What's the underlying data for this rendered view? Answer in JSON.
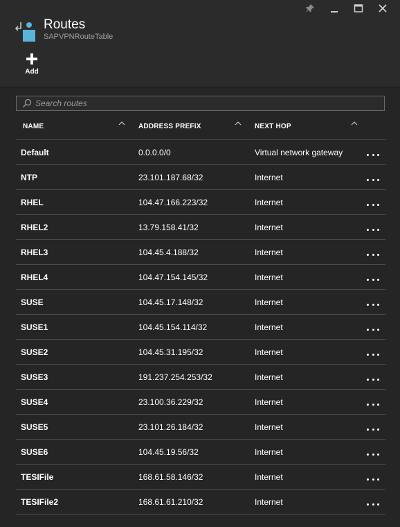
{
  "window": {
    "controls": [
      "pin-icon",
      "minimize-icon",
      "maximize-icon",
      "close-icon"
    ]
  },
  "blade": {
    "title": "Routes",
    "subtitle": "SAPVPNRouteTable",
    "icon": "route-table-icon"
  },
  "toolbar": {
    "add_label": "Add"
  },
  "search": {
    "placeholder": "Search routes",
    "value": ""
  },
  "table": {
    "columns": [
      "NAME",
      "ADDRESS PREFIX",
      "NEXT HOP"
    ],
    "rows": [
      {
        "name": "Default",
        "prefix": "0.0.0.0/0",
        "hop": "Virtual network gateway"
      },
      {
        "name": "NTP",
        "prefix": "23.101.187.68/32",
        "hop": "Internet"
      },
      {
        "name": "RHEL",
        "prefix": "104.47.166.223/32",
        "hop": "Internet"
      },
      {
        "name": "RHEL2",
        "prefix": "13.79.158.41/32",
        "hop": "Internet"
      },
      {
        "name": "RHEL3",
        "prefix": "104.45.4.188/32",
        "hop": "Internet"
      },
      {
        "name": "RHEL4",
        "prefix": "104.47.154.145/32",
        "hop": "Internet"
      },
      {
        "name": "SUSE",
        "prefix": "104.45.17.148/32",
        "hop": "Internet"
      },
      {
        "name": "SUSE1",
        "prefix": "104.45.154.114/32",
        "hop": "Internet"
      },
      {
        "name": "SUSE2",
        "prefix": "104.45.31.195/32",
        "hop": "Internet"
      },
      {
        "name": "SUSE3",
        "prefix": "191.237.254.253/32",
        "hop": "Internet"
      },
      {
        "name": "SUSE4",
        "prefix": "23.100.36.229/32",
        "hop": "Internet"
      },
      {
        "name": "SUSE5",
        "prefix": "23.101.26.184/32",
        "hop": "Internet"
      },
      {
        "name": "SUSE6",
        "prefix": "104.45.19.56/32",
        "hop": "Internet"
      },
      {
        "name": "TESIFile",
        "prefix": "168.61.58.146/32",
        "hop": "Internet"
      },
      {
        "name": "TESIFile2",
        "prefix": "168.61.61.210/32",
        "hop": "Internet"
      }
    ]
  },
  "colors": {
    "background": "#252526",
    "header": "#2b2b2b",
    "accent": "#59b4d9",
    "divider": "#4a4a4a"
  }
}
